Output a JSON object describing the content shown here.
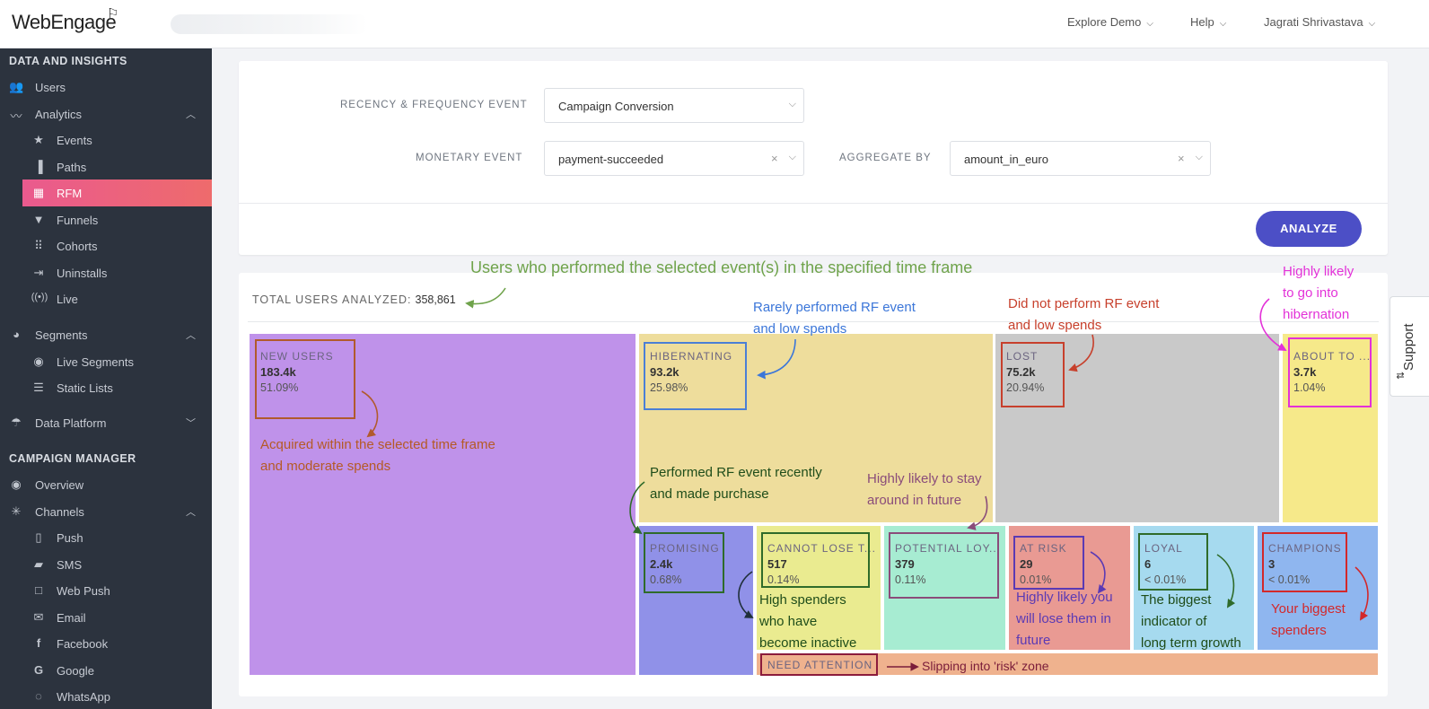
{
  "app": {
    "logo": "WebEngage"
  },
  "topnav": {
    "explore": "Explore Demo",
    "help": "Help",
    "user": "Jagrati Shrivastava"
  },
  "sidebar": {
    "section1": "DATA AND INSIGHTS",
    "section2": "CAMPAIGN MANAGER",
    "items": {
      "users": "Users",
      "analytics": "Analytics",
      "events": "Events",
      "paths": "Paths",
      "rfm": "RFM",
      "funnels": "Funnels",
      "cohorts": "Cohorts",
      "uninstalls": "Uninstalls",
      "live": "Live",
      "segments": "Segments",
      "live_segments": "Live Segments",
      "static_lists": "Static Lists",
      "data_platform": "Data Platform",
      "overview": "Overview",
      "channels": "Channels",
      "push": "Push",
      "sms": "SMS",
      "web_push": "Web Push",
      "email": "Email",
      "facebook": "Facebook",
      "google": "Google",
      "whatsapp": "WhatsApp"
    }
  },
  "form": {
    "rf_label": "RECENCY & FREQUENCY EVENT",
    "rf_value": "Campaign Conversion",
    "monetary_label": "MONETARY EVENT",
    "monetary_value": "payment-succeeded",
    "aggregate_label": "AGGREGATE BY",
    "aggregate_value": "amount_in_euro",
    "analyze": "ANALYZE"
  },
  "summary": {
    "label": "TOTAL USERS ANALYZED:",
    "value": "358,861"
  },
  "segments": {
    "new_users": {
      "name": "NEW USERS",
      "count": "183.4k",
      "pct": "51.09%"
    },
    "hibernating": {
      "name": "HIBERNATING",
      "count": "93.2k",
      "pct": "25.98%"
    },
    "lost": {
      "name": "LOST",
      "count": "75.2k",
      "pct": "20.94%"
    },
    "about_to": {
      "name": "ABOUT TO ...",
      "count": "3.7k",
      "pct": "1.04%"
    },
    "promising": {
      "name": "PROMISING",
      "count": "2.4k",
      "pct": "0.68%"
    },
    "cannot_lose": {
      "name": "CANNOT LOSE T...",
      "count": "517",
      "pct": "0.14%"
    },
    "potential_loyal": {
      "name": "POTENTIAL LOY...",
      "count": "379",
      "pct": "0.11%"
    },
    "at_risk": {
      "name": "AT RISK",
      "count": "29",
      "pct": "0.01%"
    },
    "loyal": {
      "name": "LOYAL",
      "count": "6",
      "pct": "< 0.01%"
    },
    "champions": {
      "name": "CHAMPIONS",
      "count": "3",
      "pct": "< 0.01%"
    },
    "need_attention": {
      "name": "NEED ATTENTION"
    }
  },
  "annotations": {
    "top": "Users who performed the selected event(s) in the specified time frame",
    "hibernating": [
      "Rarely performed RF event",
      "and low spends"
    ],
    "lost": [
      "Did not perform RF event",
      "and low spends"
    ],
    "about_to": [
      "Highly likely",
      "to go into",
      "hibernation"
    ],
    "new_users": [
      "Acquired within the selected time frame",
      "and moderate spends"
    ],
    "promising": [
      "Performed RF event recently",
      "and made purchase"
    ],
    "potential_loyal": [
      "Highly likely to stay",
      "around in future"
    ],
    "cannot_lose": [
      "High spenders",
      "who have",
      "become inactive"
    ],
    "at_risk": [
      "Highly likely you",
      "will lose them in",
      "future"
    ],
    "loyal": [
      "The biggest",
      "indicator of",
      "long term growth"
    ],
    "champions": [
      "Your biggest",
      "spenders"
    ],
    "need_attention": "Slipping into 'risk' zone"
  },
  "support": "Support",
  "colors": {
    "new_users": "#bf92ea",
    "hibernating": "#eedd9c",
    "lost": "#c9c9c9",
    "about_to": "#f6e98a",
    "promising": "#9091e8",
    "cannot_lose": "#eaeb90",
    "potential_loyal": "#a7ecd2",
    "at_risk": "#e99a93",
    "loyal": "#a6daef",
    "champions": "#8fb6ef",
    "need_attention": "#efb28e"
  }
}
